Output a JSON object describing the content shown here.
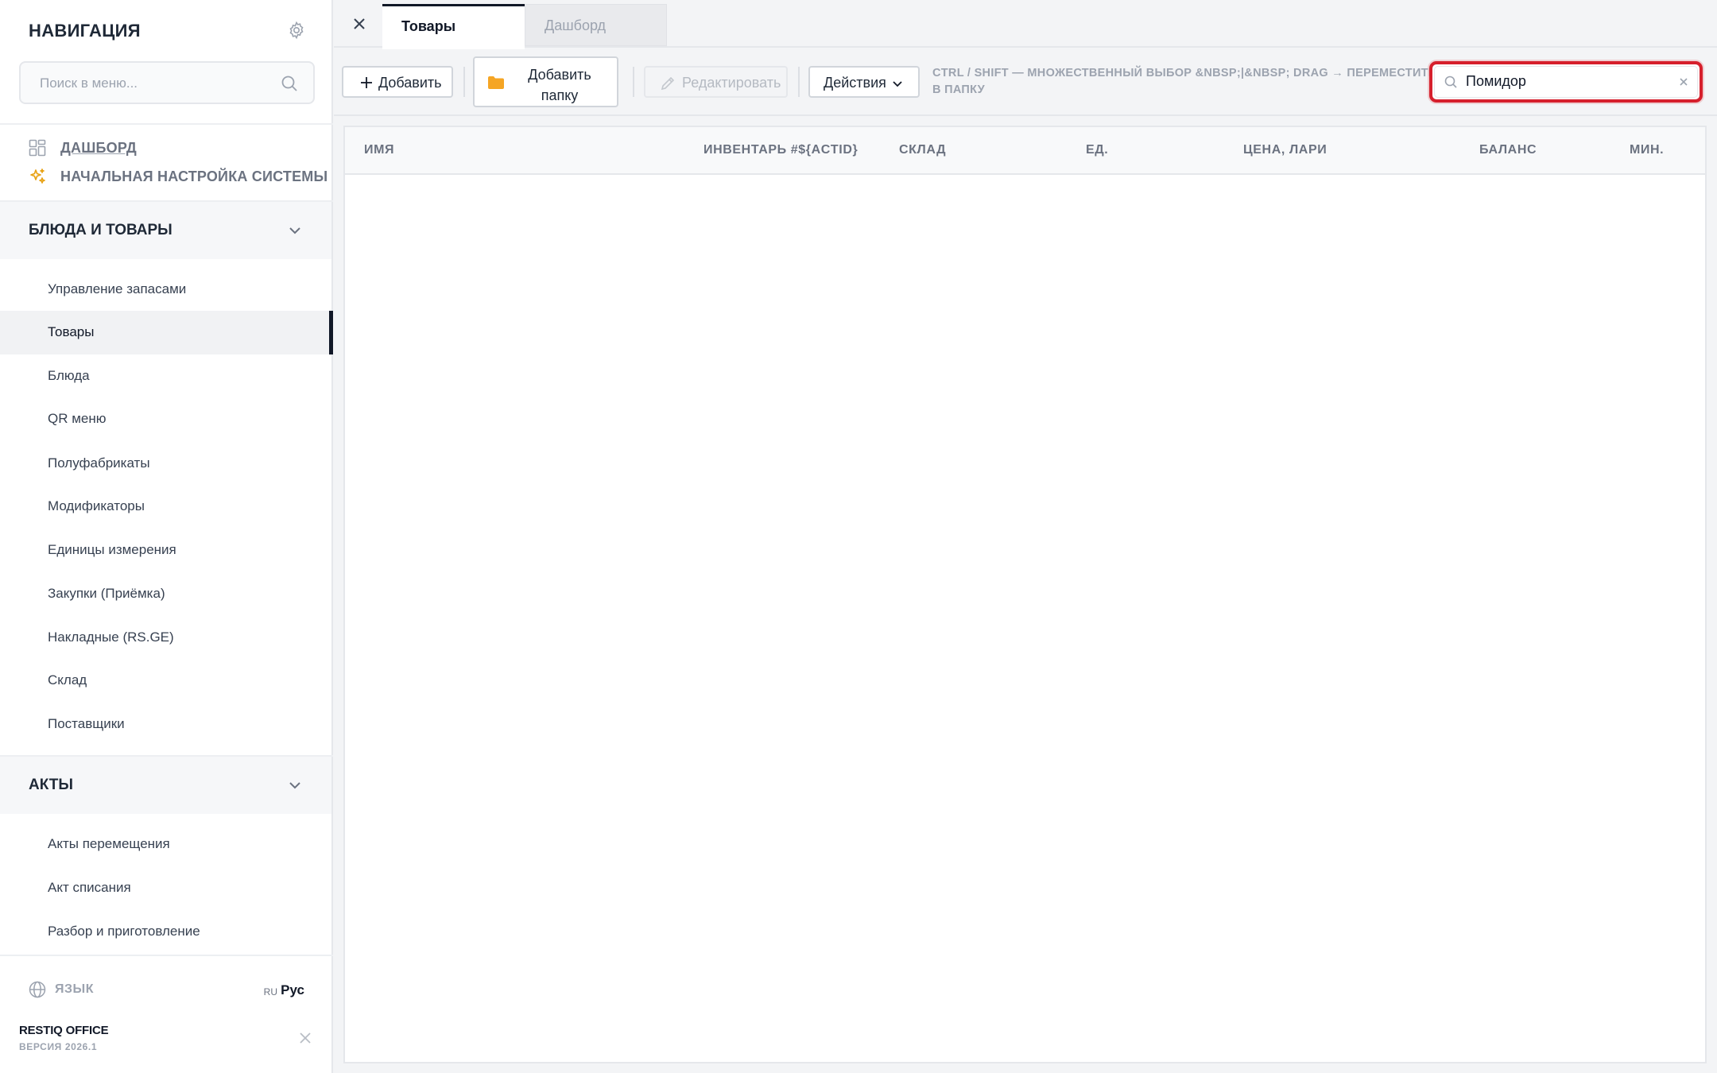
{
  "sidebar": {
    "title": "НАВИГАЦИЯ",
    "search_placeholder": "Поиск в меню...",
    "top_links": [
      {
        "label": "ДАШБОРД",
        "icon": "dashboard-grid-icon"
      },
      {
        "label": "НАЧАЛЬНАЯ НАСТРОЙКА СИСТЕМЫ",
        "icon": "sparkles-icon"
      }
    ],
    "sections": [
      {
        "label": "БЛЮДА И ТОВАРЫ",
        "expanded": true,
        "items": [
          {
            "label": "Управление запасами",
            "active": false
          },
          {
            "label": "Товары",
            "active": true
          },
          {
            "label": "Блюда",
            "active": false
          },
          {
            "label": "QR меню",
            "active": false
          },
          {
            "label": "Полуфабрикаты",
            "active": false
          },
          {
            "label": "Модификаторы",
            "active": false
          },
          {
            "label": "Единицы измерения",
            "active": false
          },
          {
            "label": "Закупки (Приёмка)",
            "active": false
          },
          {
            "label": "Накладные (RS.GE)",
            "active": false
          },
          {
            "label": "Склад",
            "active": false
          },
          {
            "label": "Поставщики",
            "active": false
          }
        ]
      },
      {
        "label": "АКТЫ",
        "expanded": true,
        "items": [
          {
            "label": "Акты перемещения",
            "active": false
          },
          {
            "label": "Акт списания",
            "active": false
          },
          {
            "label": "Разбор и приготовление",
            "active": false
          }
        ]
      }
    ],
    "language": {
      "label": "ЯЗЫК",
      "code": "RU",
      "value": "Рус"
    },
    "brand": "RESTIQ OFFICE",
    "version": "ВЕРСИЯ 2026.1"
  },
  "tabs": [
    {
      "label": "Товары",
      "active": true
    },
    {
      "label": "Дашборд",
      "active": false
    }
  ],
  "toolbar": {
    "add_label": "Добавить",
    "add_folder_label": "Добавить папку",
    "edit_label": "Редактировать",
    "actions_label": "Действия",
    "hint": "CTRL / SHIFT — МНОЖЕСТВЕННЫЙ ВЫБОР &NBSP;|&NBSP; DRAG → ПЕРЕМЕСТИТЬ В ПАПКУ",
    "search_value": "Помидор"
  },
  "table": {
    "columns": [
      "ИМЯ",
      "ИНВЕНТАРЬ #${ACTID}",
      "СКЛАД",
      "ЕД.",
      "ЦЕНА, ЛАРИ",
      "БАЛАНС",
      "МИН."
    ],
    "rows": []
  },
  "colors": {
    "accent": "#111827",
    "search_highlight": "#d61f2c",
    "folder_icon": "#f5a524",
    "setup_icon": "#e8a317"
  }
}
